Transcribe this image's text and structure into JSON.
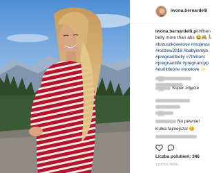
{
  "post": {
    "username": "iwona.bernardelli",
    "username_short": "iwona.bernardelli.pl"
  },
  "caption": {
    "username": "iwona.bernardelli.pl",
    "lines": [
      "When",
      "belly more than abs",
      "#brzuszkowelove #mojewsi",
      "#rodzew2018 #babyinmyb",
      "#pregnantbelly #7thmont",
      "#pregnantlife #pregnancyp",
      "#ourlittleone #onelove ✨"
    ]
  },
  "comments": [
    {
      "text": "Super zdjęcie"
    },
    {
      "text": "No pewnie!"
    },
    {
      "text": "Kulka fajniejsza!"
    }
  ],
  "footer": {
    "likes": "Liczba polubień: 346",
    "date": "1 DZIEŃ TEMU"
  },
  "colors": {
    "hashtag": "#003569",
    "text": "#262626",
    "muted": "#999999",
    "border": "#efefef"
  },
  "icons": {
    "like": "heart-icon",
    "comment": "speech-bubble-icon",
    "share": "share-icon",
    "comment_like": "small-heart-icon"
  }
}
